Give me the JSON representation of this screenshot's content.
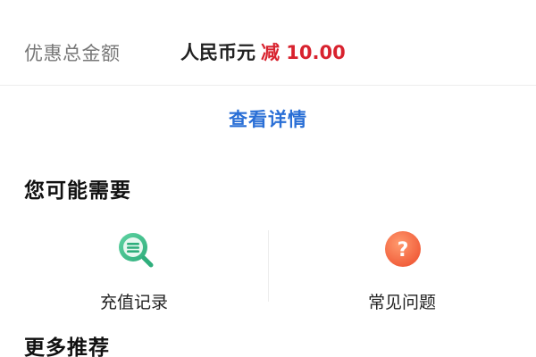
{
  "discount": {
    "label": "优惠总金额",
    "currency": "人民币元",
    "amount": "减 10.00"
  },
  "details_link": "查看详情",
  "you_may_need": {
    "title": "您可能需要",
    "items": [
      {
        "label": "充值记录",
        "icon": "records-search-icon",
        "color": "#3dbd8a"
      },
      {
        "label": "常见问题",
        "icon": "question-icon",
        "color": "#f1633f"
      }
    ]
  },
  "more_recommend": {
    "title": "更多推荐"
  }
}
